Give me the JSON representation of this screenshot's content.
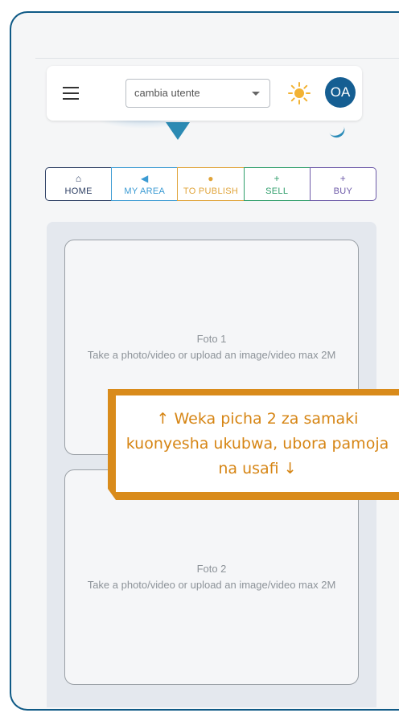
{
  "header": {
    "user_select_value": "cambia utente",
    "avatar_initials": "OA"
  },
  "nav": [
    {
      "label": "HOME",
      "icon": "home-icon",
      "glyph": "⌂",
      "color": "#2c3e63"
    },
    {
      "label": "MY AREA",
      "icon": "megaphone-icon",
      "glyph": "◀",
      "color": "#3c9bd3"
    },
    {
      "label": "TO PUBLISH",
      "icon": "check-circle-icon",
      "glyph": "●",
      "color": "#e0a43a"
    },
    {
      "label": "SELL",
      "icon": "plus-icon",
      "glyph": "+",
      "color": "#2f9e6b"
    },
    {
      "label": "BUY",
      "icon": "plus-icon",
      "glyph": "+",
      "color": "#6d5aa8"
    }
  ],
  "photos": [
    {
      "title": "Foto 1",
      "hint": "Take a photo/video or upload an image/video max 2M"
    },
    {
      "title": "Foto 2",
      "hint": "Take a photo/video or upload an image/video max 2M"
    }
  ],
  "callout": {
    "text": "↑ Weka picha 2 za samaki kuonyesha ukubwa, ubora pamoja na usafi ↓"
  },
  "colors": {
    "frame": "#0f5a86",
    "avatar_bg": "#155e92",
    "callout": "#d98b1b",
    "sun": "#f2b233"
  }
}
